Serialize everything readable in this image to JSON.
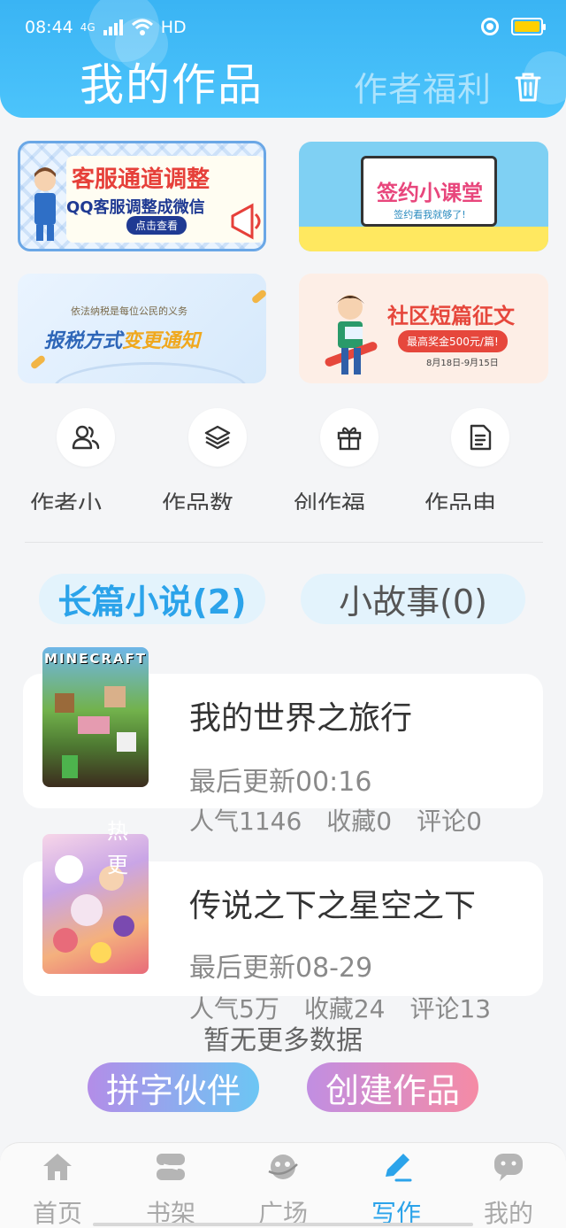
{
  "status_bar": {
    "time": "08:44",
    "network": "4G",
    "hd": "HD"
  },
  "header": {
    "title": "我的作品",
    "welfare_link": "作者福利"
  },
  "banners": [
    {
      "line1": "客服通道调整",
      "line2": "QQ客服调整成微信",
      "button": "点击查看"
    },
    {
      "line1": "签约小课堂",
      "line2": "签约看我就够了!"
    },
    {
      "line1": "依法纳税是每位公民的义务",
      "line2a": "报税方式",
      "line2b": "变更通知"
    },
    {
      "line1": "社区短篇征文",
      "line2": "最高奖金500元/篇!",
      "line3": "8月18日-9月15日"
    }
  ],
  "quick_actions": [
    {
      "label": "作者小",
      "icon": "users-icon"
    },
    {
      "label": "作品数",
      "icon": "layers-icon"
    },
    {
      "label": "创作福",
      "icon": "gift-icon"
    },
    {
      "label": "作品申",
      "icon": "document-icon"
    }
  ],
  "tabs": [
    {
      "label": "长篇小说(2)",
      "active": true
    },
    {
      "label": "小故事(0)",
      "active": false
    }
  ],
  "works": [
    {
      "cover_text": "MINECRAFT",
      "title": "我的世界之旅行",
      "updated": "最后更新00:16",
      "popularity": "人气1146",
      "favorites": "收藏0",
      "comments": "评论0"
    },
    {
      "cover_badge": "热 更",
      "title": "传说之下之星空之下",
      "updated": "最后更新08-29",
      "popularity": "人气5万",
      "favorites": "收藏24",
      "comments": "评论13"
    }
  ],
  "no_more": "暂无更多数据",
  "actions": {
    "partner": "拼字伙伴",
    "create": "创建作品"
  },
  "nav": [
    {
      "label": "首页",
      "icon": "home-icon"
    },
    {
      "label": "书架",
      "icon": "bookshelf-icon"
    },
    {
      "label": "广场",
      "icon": "planet-icon"
    },
    {
      "label": "写作",
      "icon": "pen-icon",
      "active": true
    },
    {
      "label": "我的",
      "icon": "chat-face-icon"
    }
  ],
  "colors": {
    "accent": "#2ba3ea",
    "header": "#3ab4f4",
    "tab_bg": "#e3f3fc"
  }
}
